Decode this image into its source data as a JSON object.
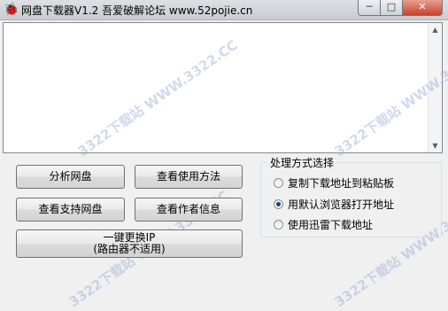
{
  "window": {
    "app_icon": "🐞",
    "title": "网盘下载器V1.2    吾爱破解论坛 www.52pojie.cn",
    "controls": {
      "minimize": "─",
      "maximize": "□",
      "close": "✕"
    }
  },
  "log": {
    "scroll_up": "▲",
    "scroll_down": "▼"
  },
  "buttons": {
    "analyze": "分析网盘",
    "howto": "查看使用方法",
    "supported": "查看支持网盘",
    "author": "查看作者信息",
    "changeip_line1": "一键更换IP",
    "changeip_line2": "(路由器不适用)"
  },
  "processing": {
    "title": "处理方式选择",
    "options": [
      {
        "label": "复制下载地址到粘贴板",
        "checked": false
      },
      {
        "label": "用默认浏览器打开地址",
        "checked": true
      },
      {
        "label": "使用迅雷下载地址",
        "checked": false
      }
    ]
  },
  "watermark": {
    "text": "3322下载站  WWW.3322.CC"
  }
}
